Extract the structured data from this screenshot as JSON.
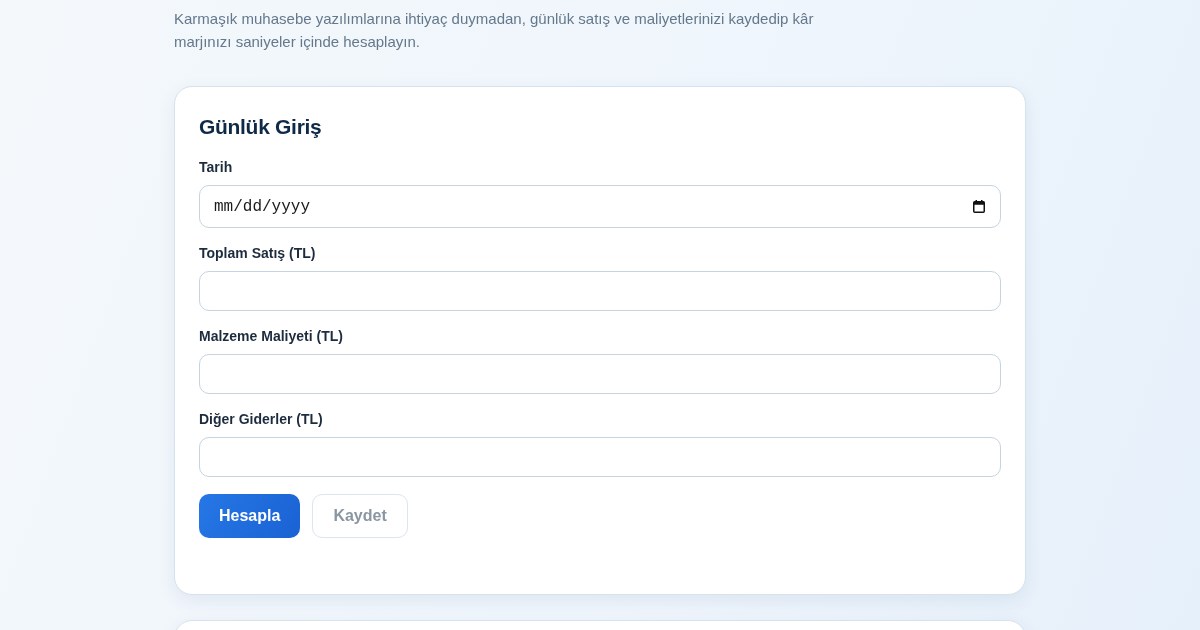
{
  "intro": "Karmaşık muhasebe yazılımlarına ihtiyaç duymadan, günlük satış ve maliyetlerinizi kaydedip kâr marjınızı saniyeler içinde hesaplayın.",
  "entry_card": {
    "title": "Günlük Giriş",
    "fields": [
      {
        "label": "Tarih",
        "kind": "date",
        "placeholder": "mm/dd/yyyy"
      },
      {
        "label": "Toplam Satış (TL)",
        "kind": "text"
      },
      {
        "label": "Malzeme Maliyeti (TL)",
        "kind": "text"
      },
      {
        "label": "Diğer Giderler (TL)",
        "kind": "text"
      }
    ],
    "buttons": [
      {
        "label": "Hesapla",
        "kind": "primary",
        "disabled": false
      },
      {
        "label": "Kaydet",
        "kind": "secondary",
        "disabled": true
      }
    ]
  }
}
